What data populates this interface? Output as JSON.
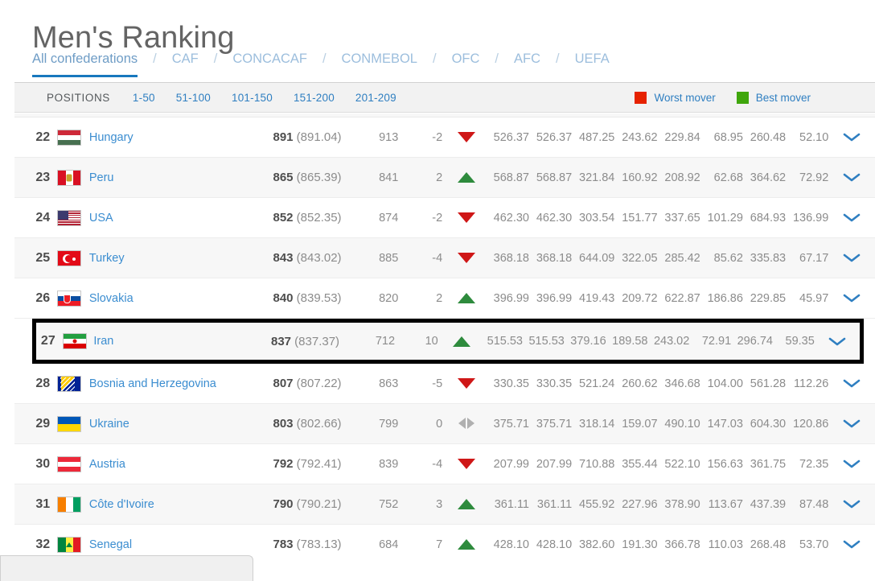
{
  "page_title": "Men's Ranking",
  "confederations": {
    "separator": "/",
    "tabs": [
      {
        "label": "All confederations",
        "active": true
      },
      {
        "label": "CAF",
        "active": false
      },
      {
        "label": "CONCACAF",
        "active": false
      },
      {
        "label": "CONMEBOL",
        "active": false
      },
      {
        "label": "OFC",
        "active": false
      },
      {
        "label": "AFC",
        "active": false
      },
      {
        "label": "UEFA",
        "active": false
      }
    ]
  },
  "positions": {
    "label": "POSITIONS",
    "ranges": [
      "1-50",
      "51-100",
      "101-150",
      "151-200",
      "201-209"
    ],
    "legend": [
      {
        "label": "Worst mover",
        "color": "#e62200",
        "icon": "red-square-icon"
      },
      {
        "label": "Best mover",
        "color": "#3fa60c",
        "icon": "green-square-icon"
      }
    ]
  },
  "table": {
    "chevron_icon": "chevron-down-icon",
    "rows": [
      {
        "rank": "22",
        "team": "Hungary",
        "flag": "hungary-flag",
        "points": "891",
        "points_exact": "(891.04)",
        "previous": "913",
        "delta": "-2",
        "trend": "down",
        "values": [
          "526.37",
          "526.37",
          "487.25",
          "243.62",
          "229.84",
          "68.95",
          "260.48",
          "52.10"
        ],
        "highlighted": false
      },
      {
        "rank": "23",
        "team": "Peru",
        "flag": "peru-flag",
        "points": "865",
        "points_exact": "(865.39)",
        "previous": "841",
        "delta": "2",
        "trend": "up",
        "values": [
          "568.87",
          "568.87",
          "321.84",
          "160.92",
          "208.92",
          "62.68",
          "364.62",
          "72.92"
        ],
        "highlighted": false
      },
      {
        "rank": "24",
        "team": "USA",
        "flag": "usa-flag",
        "points": "852",
        "points_exact": "(852.35)",
        "previous": "874",
        "delta": "-2",
        "trend": "down",
        "values": [
          "462.30",
          "462.30",
          "303.54",
          "151.77",
          "337.65",
          "101.29",
          "684.93",
          "136.99"
        ],
        "highlighted": false
      },
      {
        "rank": "25",
        "team": "Turkey",
        "flag": "turkey-flag",
        "points": "843",
        "points_exact": "(843.02)",
        "previous": "885",
        "delta": "-4",
        "trend": "down",
        "values": [
          "368.18",
          "368.18",
          "644.09",
          "322.05",
          "285.42",
          "85.62",
          "335.83",
          "67.17"
        ],
        "highlighted": false
      },
      {
        "rank": "26",
        "team": "Slovakia",
        "flag": "slovakia-flag",
        "points": "840",
        "points_exact": "(839.53)",
        "previous": "820",
        "delta": "2",
        "trend": "up",
        "values": [
          "396.99",
          "396.99",
          "419.43",
          "209.72",
          "622.87",
          "186.86",
          "229.85",
          "45.97"
        ],
        "highlighted": false
      },
      {
        "rank": "27",
        "team": "Iran",
        "flag": "iran-flag",
        "points": "837",
        "points_exact": "(837.37)",
        "previous": "712",
        "delta": "10",
        "trend": "up",
        "values": [
          "515.53",
          "515.53",
          "379.16",
          "189.58",
          "243.02",
          "72.91",
          "296.74",
          "59.35"
        ],
        "highlighted": true
      },
      {
        "rank": "28",
        "team": "Bosnia and Herzegovina",
        "flag": "bosnia-flag",
        "points": "807",
        "points_exact": "(807.22)",
        "previous": "863",
        "delta": "-5",
        "trend": "down",
        "values": [
          "330.35",
          "330.35",
          "521.24",
          "260.62",
          "346.68",
          "104.00",
          "561.28",
          "112.26"
        ],
        "highlighted": false
      },
      {
        "rank": "29",
        "team": "Ukraine",
        "flag": "ukraine-flag",
        "points": "803",
        "points_exact": "(802.66)",
        "previous": "799",
        "delta": "0",
        "trend": "same",
        "values": [
          "375.71",
          "375.71",
          "318.14",
          "159.07",
          "490.10",
          "147.03",
          "604.30",
          "120.86"
        ],
        "highlighted": false
      },
      {
        "rank": "30",
        "team": "Austria",
        "flag": "austria-flag",
        "points": "792",
        "points_exact": "(792.41)",
        "previous": "839",
        "delta": "-4",
        "trend": "down",
        "values": [
          "207.99",
          "207.99",
          "710.88",
          "355.44",
          "522.10",
          "156.63",
          "361.75",
          "72.35"
        ],
        "highlighted": false
      },
      {
        "rank": "31",
        "team": "Côte d'Ivoire",
        "flag": "cote-divoire-flag",
        "points": "790",
        "points_exact": "(790.21)",
        "previous": "752",
        "delta": "3",
        "trend": "up",
        "values": [
          "361.11",
          "361.11",
          "455.92",
          "227.96",
          "378.90",
          "113.67",
          "437.39",
          "87.48"
        ],
        "highlighted": false
      },
      {
        "rank": "32",
        "team": "Senegal",
        "flag": "senegal-flag",
        "points": "783",
        "points_exact": "(783.13)",
        "previous": "684",
        "delta": "7",
        "trend": "up",
        "values": [
          "428.10",
          "428.10",
          "382.60",
          "191.30",
          "366.78",
          "110.03",
          "268.48",
          "53.70"
        ],
        "highlighted": false
      }
    ]
  }
}
